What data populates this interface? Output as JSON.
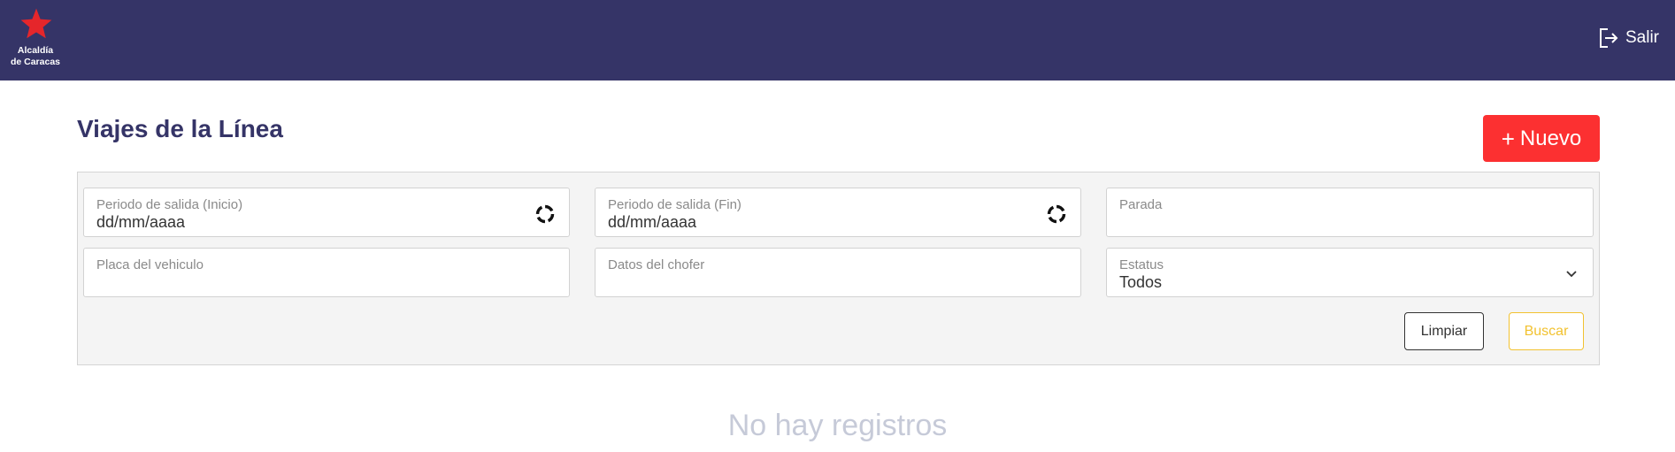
{
  "header": {
    "logo_text_line1": "Alcaldía",
    "logo_text_line2": "de Caracas",
    "logout_label": "Salir",
    "logout_icon": "logout-icon",
    "star_color": "#e5262b",
    "bar_color": "#353467"
  },
  "main": {
    "title": "Viajes de la Línea",
    "new_button_icon_text": "+",
    "new_button_label": "Nuevo",
    "new_button_color": "#fc3031"
  },
  "filters": {
    "start_period": {
      "label": "Periodo de salida (Inicio)",
      "value": "dd/mm/aaaa",
      "icon": "calendar-icon"
    },
    "end_period": {
      "label": "Periodo de salida (Fin)",
      "value": "dd/mm/aaaa",
      "icon": "calendar-icon"
    },
    "stop": {
      "label": "Parada",
      "value": ""
    },
    "vehicle_plate": {
      "label": "Placa del vehiculo",
      "value": ""
    },
    "driver_data": {
      "label": "Datos del chofer",
      "value": ""
    },
    "status": {
      "label": "Estatus",
      "value": "Todos",
      "icon": "chevron-down-icon"
    },
    "clear_label": "Limpiar",
    "search_label": "Buscar"
  },
  "results": {
    "empty_message": "No hay registros"
  }
}
